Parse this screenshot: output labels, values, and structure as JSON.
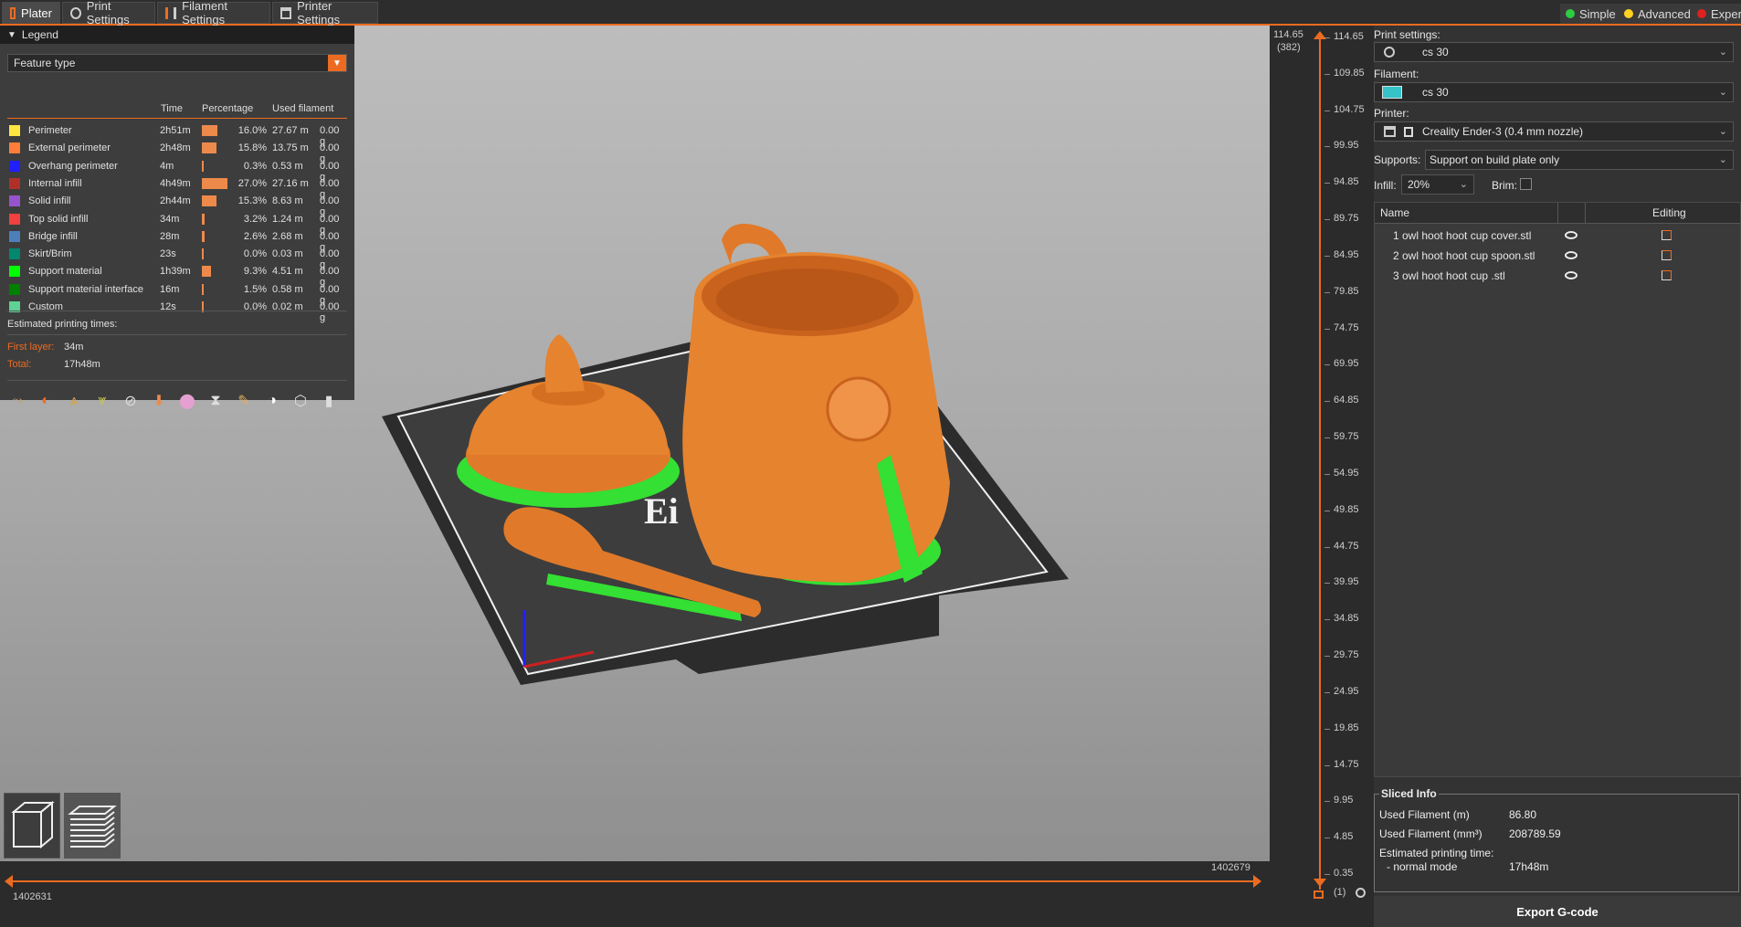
{
  "tabs": [
    {
      "label": "Plater",
      "icon": "plater-icon"
    },
    {
      "label": "Print Settings",
      "icon": "gear-icon"
    },
    {
      "label": "Filament Settings",
      "icon": "filament-spool-icon"
    },
    {
      "label": "Printer Settings",
      "icon": "printer-icon"
    }
  ],
  "modes": [
    {
      "label": "Simple",
      "color": "#2ecc40"
    },
    {
      "label": "Advanced",
      "color": "#ffd21f"
    },
    {
      "label": "Exper",
      "color": "#e02020"
    }
  ],
  "legend": {
    "title": "Legend",
    "view_type": "Feature type",
    "headers": {
      "time": "Time",
      "percentage": "Percentage",
      "used_filament": "Used filament"
    },
    "rows": [
      {
        "name": "Perimeter",
        "color": "#ffe640",
        "time": "2h51m",
        "pct_value": 16.0,
        "pct": "16.0%",
        "length": "27.67 m",
        "weight": "0.00 g"
      },
      {
        "name": "External perimeter",
        "color": "#ff7d38",
        "time": "2h48m",
        "pct_value": 15.8,
        "pct": "15.8%",
        "length": "13.75 m",
        "weight": "0.00 g"
      },
      {
        "name": "Overhang perimeter",
        "color": "#1f1fff",
        "time": "4m",
        "pct_value": 0.3,
        "pct": "0.3%",
        "length": "0.53 m",
        "weight": "0.00 g"
      },
      {
        "name": "Internal infill",
        "color": "#b03029",
        "time": "4h49m",
        "pct_value": 27.0,
        "pct": "27.0%",
        "length": "27.16 m",
        "weight": "0.00 g"
      },
      {
        "name": "Solid infill",
        "color": "#9654cc",
        "time": "2h44m",
        "pct_value": 15.3,
        "pct": "15.3%",
        "length": "8.63 m",
        "weight": "0.00 g"
      },
      {
        "name": "Top solid infill",
        "color": "#f04040",
        "time": "34m",
        "pct_value": 3.2,
        "pct": "3.2%",
        "length": "1.24 m",
        "weight": "0.00 g"
      },
      {
        "name": "Bridge infill",
        "color": "#4d80ba",
        "time": "28m",
        "pct_value": 2.6,
        "pct": "2.6%",
        "length": "2.68 m",
        "weight": "0.00 g"
      },
      {
        "name": "Skirt/Brim",
        "color": "#00876e",
        "time": "23s",
        "pct_value": 0.0,
        "pct": "0.0%",
        "length": "0.03 m",
        "weight": "0.00 g"
      },
      {
        "name": "Support material",
        "color": "#00ff00",
        "time": "1h39m",
        "pct_value": 9.3,
        "pct": "9.3%",
        "length": "4.51 m",
        "weight": "0.00 g"
      },
      {
        "name": "Support material interface",
        "color": "#008000",
        "time": "16m",
        "pct_value": 1.5,
        "pct": "1.5%",
        "length": "0.58 m",
        "weight": "0.00 g"
      },
      {
        "name": "Custom",
        "color": "#5ed194",
        "time": "12s",
        "pct_value": 0.0,
        "pct": "0.0%",
        "length": "0.02 m",
        "weight": "0.00 g"
      }
    ],
    "estimated_label": "Estimated printing times:",
    "first_layer_label": "First layer:",
    "first_layer_value": "34m",
    "total_label": "Total:",
    "total_value": "17h48m",
    "toolbar_icons": [
      "travel-icon",
      "wipe-icon",
      "retractions-icon",
      "deretractions-icon",
      "seams-icon",
      "tool-changes-icon",
      "color-changes-icon",
      "pause-prints-icon",
      "custom-gcodes-icon",
      "center-of-gravity-icon",
      "shells-icon",
      "tool-marker-icon"
    ]
  },
  "viewport": {
    "bed_label": "Ei",
    "bottom_left_value": "1402631",
    "bottom_right_value": "1402679",
    "view_buttons": [
      "3d-view-icon",
      "layers-view-icon"
    ]
  },
  "vertical_slider": {
    "top_value": "114.65",
    "top_layer": "(382)",
    "bottom_value": "0.35",
    "bottom_layer": "(1)",
    "ticks": [
      "114.65",
      "109.85",
      "104.75",
      "99.95",
      "94.85",
      "89.75",
      "84.95",
      "79.85",
      "74.75",
      "69.95",
      "64.85",
      "59.75",
      "54.95",
      "49.85",
      "44.75",
      "39.95",
      "34.85",
      "29.75",
      "24.95",
      "19.85",
      "14.75",
      "9.95",
      "4.85",
      "0.35"
    ]
  },
  "right_panel": {
    "print_settings_label": "Print settings:",
    "print_settings_value": "cs 30",
    "filament_label": "Filament:",
    "filament_value": "cs 30",
    "filament_color": "#35c3c8",
    "printer_label": "Printer:",
    "printer_value": "Creality Ender-3 (0.4 mm nozzle)",
    "supports_label": "Supports:",
    "supports_value": "Support on build plate only",
    "infill_label": "Infill:",
    "infill_value": "20%",
    "brim_label": "Brim:",
    "brim_checked": false,
    "list_headers": {
      "name": "Name",
      "editing": "Editing"
    },
    "objects": [
      {
        "name": "1 owl hoot hoot cup cover.stl"
      },
      {
        "name": "2 owl hoot hoot cup spoon.stl"
      },
      {
        "name": "3 owl hoot hoot cup .stl"
      }
    ],
    "sliced_info": {
      "title": "Sliced Info",
      "used_filament_m_label": "Used Filament (m)",
      "used_filament_m_value": "86.80",
      "used_filament_mm3_label": "Used Filament (mm³)",
      "used_filament_mm3_value": "208789.59",
      "est_time_label": "Estimated printing time:",
      "normal_mode_label": "- normal mode",
      "normal_mode_value": "17h48m"
    },
    "export_label": "Export G-code"
  }
}
